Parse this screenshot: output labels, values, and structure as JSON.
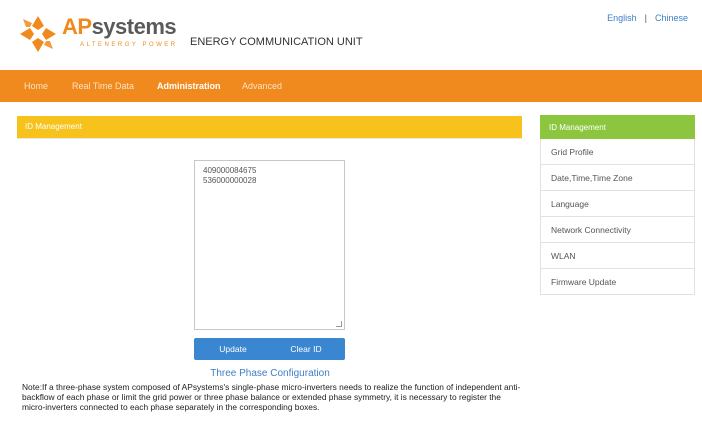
{
  "header": {
    "logo_prefix": "AP",
    "logo_suffix": "systems",
    "logo_tagline": "ALTENERGY POWER",
    "unit_title": "ENERGY COMMUNICATION UNIT",
    "lang_en": "English",
    "lang_sep": "|",
    "lang_cn": "Chinese",
    "brand_color": "#f08a1e"
  },
  "nav": {
    "items": [
      {
        "label": "Home",
        "active": false
      },
      {
        "label": "Real Time Data",
        "active": false
      },
      {
        "label": "Administration",
        "active": true
      },
      {
        "label": "Advanced",
        "active": false
      }
    ]
  },
  "main": {
    "panel_title": "ID Management",
    "ids": [
      "409000084675",
      "536000000028"
    ],
    "update_label": "Update",
    "clear_label": "Clear ID",
    "three_phase_link": "Three Phase Configuration",
    "note": "Note:If a three-phase system composed of APsystems's single-phase micro-inverters needs to realize the function of independent anti-backflow of each phase or limit the grid power or three phase balance or extended phase symmetry, it is necessary to register the micro-inverters connected to each phase separately in the corresponding boxes."
  },
  "sidebar": {
    "title": "ID Management",
    "items": [
      {
        "label": "Grid Profile"
      },
      {
        "label": "Date,Time,Time Zone"
      },
      {
        "label": "Language"
      },
      {
        "label": "Network Connectivity"
      },
      {
        "label": "WLAN"
      },
      {
        "label": "Firmware Update"
      }
    ]
  }
}
